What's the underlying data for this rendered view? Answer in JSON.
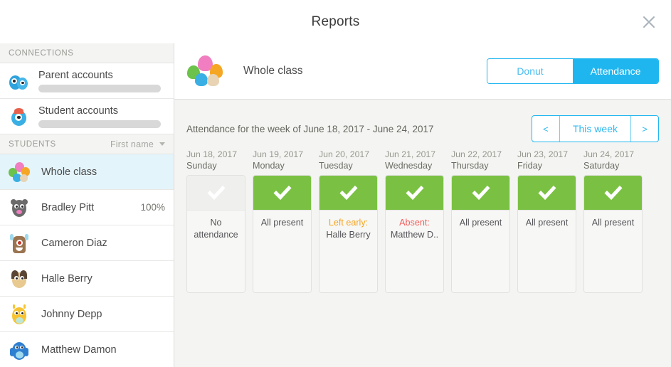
{
  "window": {
    "title": "Reports",
    "close_icon": "close-icon"
  },
  "sidebar": {
    "connections_header": "CONNECTIONS",
    "connections": [
      {
        "label": "Parent accounts",
        "avatar": "parent-monster-avatar"
      },
      {
        "label": "Student accounts",
        "avatar": "student-monster-avatar"
      }
    ],
    "students_header": "STUDENTS",
    "sort_label": "First name",
    "sort_icon": "chevron-down-icon",
    "students": [
      {
        "name": "Whole class",
        "percent": "",
        "selected": true
      },
      {
        "name": "Bradley Pitt",
        "percent": "100%",
        "selected": false
      },
      {
        "name": "Cameron Diaz",
        "percent": "",
        "selected": false
      },
      {
        "name": "Halle Berry",
        "percent": "",
        "selected": false
      },
      {
        "name": "Johnny Depp",
        "percent": "",
        "selected": false
      },
      {
        "name": "Matthew Damon",
        "percent": "",
        "selected": false
      }
    ]
  },
  "main": {
    "class_title": "Whole class",
    "class_avatar": "whole-class-group-avatar",
    "view_toggle": {
      "donut": "Donut",
      "attendance": "Attendance",
      "active": "Attendance"
    },
    "attendance_heading": "Attendance for the week of June 18, 2017 - June 24, 2017",
    "week_nav": {
      "prev": "<",
      "current": "This week",
      "next": ">"
    },
    "days": [
      {
        "date": "Jun 18, 2017",
        "weekday": "Sunday",
        "state": "none",
        "lines": [
          {
            "text": "No",
            "style": "normal"
          },
          {
            "text": "attendance",
            "style": "normal"
          }
        ]
      },
      {
        "date": "Jun 19, 2017",
        "weekday": "Monday",
        "state": "present",
        "lines": [
          {
            "text": "All present",
            "style": "normal"
          }
        ]
      },
      {
        "date": "Jun 20, 2017",
        "weekday": "Tuesday",
        "state": "present",
        "lines": [
          {
            "text": "Left early:",
            "style": "warn"
          },
          {
            "text": "Halle Berry",
            "style": "normal"
          }
        ]
      },
      {
        "date": "Jun 21, 2017",
        "weekday": "Wednesday",
        "state": "present",
        "lines": [
          {
            "text": "Absent:",
            "style": "danger"
          },
          {
            "text": "Matthew D..",
            "style": "normal"
          }
        ]
      },
      {
        "date": "Jun 22, 2017",
        "weekday": "Thursday",
        "state": "present",
        "lines": [
          {
            "text": "All present",
            "style": "normal"
          }
        ]
      },
      {
        "date": "Jun 23, 2017",
        "weekday": "Friday",
        "state": "present",
        "lines": [
          {
            "text": "All present",
            "style": "normal"
          }
        ]
      },
      {
        "date": "Jun 24, 2017",
        "weekday": "Saturday",
        "state": "present",
        "lines": [
          {
            "text": "All present",
            "style": "normal"
          }
        ]
      }
    ]
  },
  "colors": {
    "accent_blue": "#1fb6ef",
    "present_green": "#7ac143",
    "warn_orange": "#f5a623",
    "danger_red": "#f0605d",
    "selected_row": "#e4f4fb",
    "panel_bg": "#f4f4f2"
  }
}
